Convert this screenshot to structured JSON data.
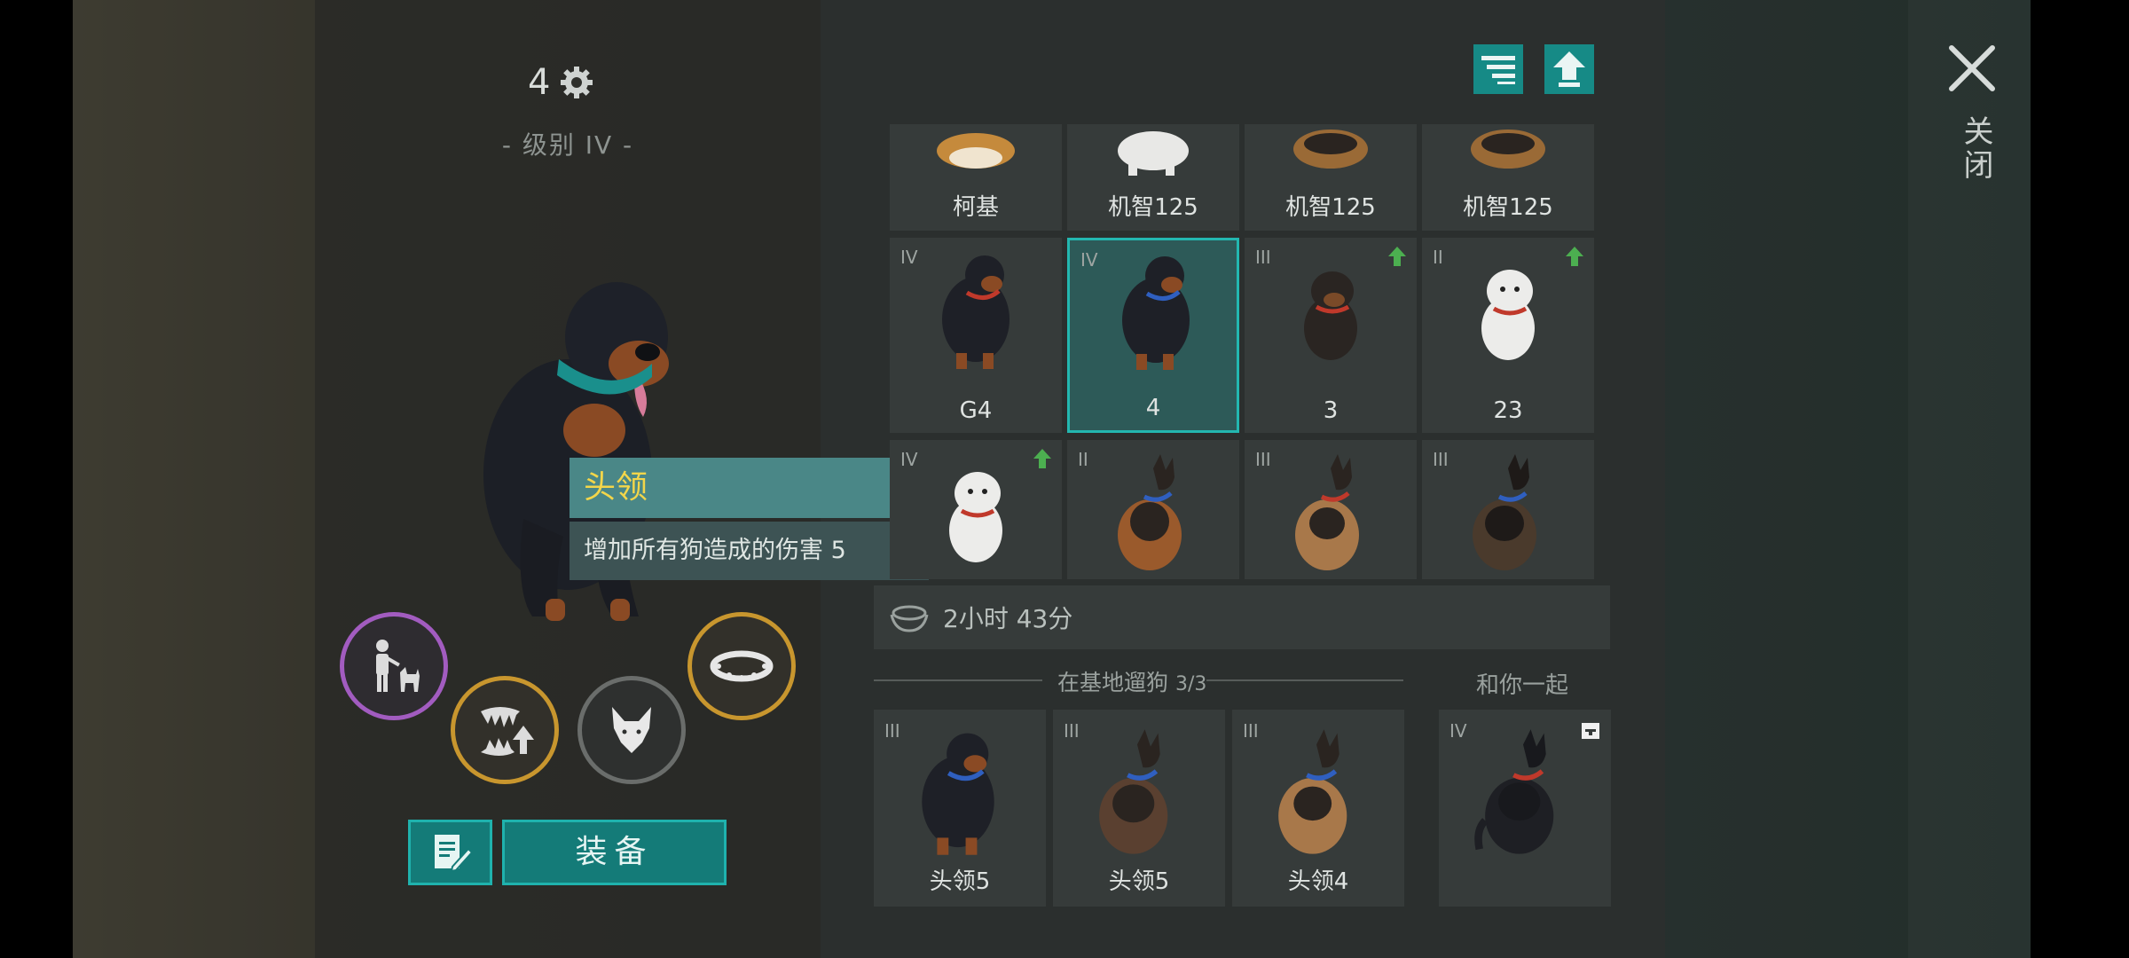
{
  "header": {
    "level_value": "4",
    "level_label": "- 级别 IV -"
  },
  "tooltip": {
    "title": "头领",
    "description": "增加所有狗造成的伤害 5"
  },
  "action_circles": [
    {
      "icon": "dog-trainer-icon",
      "color": "#a25cc0"
    },
    {
      "icon": "fangs-upgrade-icon",
      "color": "#c8962e"
    },
    {
      "icon": "wolf-head-icon",
      "color": "#6a6d6b"
    },
    {
      "icon": "spiked-collar-icon",
      "color": "#c8962e"
    }
  ],
  "buttons": {
    "equip_label": "装备",
    "note_icon": "edit-note-icon"
  },
  "toolbar": {
    "sort_icon": "sort-icon",
    "upgrade_icon": "upload-arrow-icon"
  },
  "close": {
    "label": "关闭"
  },
  "grid": {
    "row1": [
      {
        "name": "柯基",
        "breed": "corgi"
      },
      {
        "name": "机智125",
        "breed": "husky"
      },
      {
        "name": "机智125",
        "breed": "shepherd"
      },
      {
        "name": "机智125",
        "breed": "shepherd"
      }
    ],
    "row2": [
      {
        "rank": "IV",
        "name": "G4",
        "breed": "rottweiler",
        "upgrade": false
      },
      {
        "rank": "IV",
        "name": "4",
        "breed": "rottweiler",
        "upgrade": false,
        "selected": true
      },
      {
        "rank": "III",
        "name": "3",
        "breed": "puppy-dark",
        "upgrade": true
      },
      {
        "rank": "II",
        "name": "23",
        "breed": "puppy-white",
        "upgrade": true
      }
    ],
    "row3": [
      {
        "rank": "IV",
        "breed": "puppy-white",
        "upgrade": true
      },
      {
        "rank": "II",
        "breed": "shepherd"
      },
      {
        "rank": "III",
        "breed": "shepherd"
      },
      {
        "rank": "III",
        "breed": "shepherd-dark"
      }
    ]
  },
  "timer": {
    "icon": "food-bowl-icon",
    "text": "2小时 43分"
  },
  "walk_section": {
    "title": "在基地遛狗",
    "count": "3/3",
    "dogs": [
      {
        "rank": "III",
        "name": "头领5",
        "breed": "rottweiler"
      },
      {
        "rank": "III",
        "name": "头领5",
        "breed": "shepherd"
      },
      {
        "rank": "III",
        "name": "头领4",
        "breed": "shepherd"
      }
    ]
  },
  "with_you": {
    "title": "和你一起",
    "dog": {
      "rank": "IV",
      "breed": "black-shepherd",
      "badge": "storage-icon"
    }
  },
  "colors": {
    "accent": "#168a86",
    "accent_border": "#23b7b0",
    "tooltip_title": "#f3d64a",
    "upgrade_arrow": "#4caf50"
  }
}
